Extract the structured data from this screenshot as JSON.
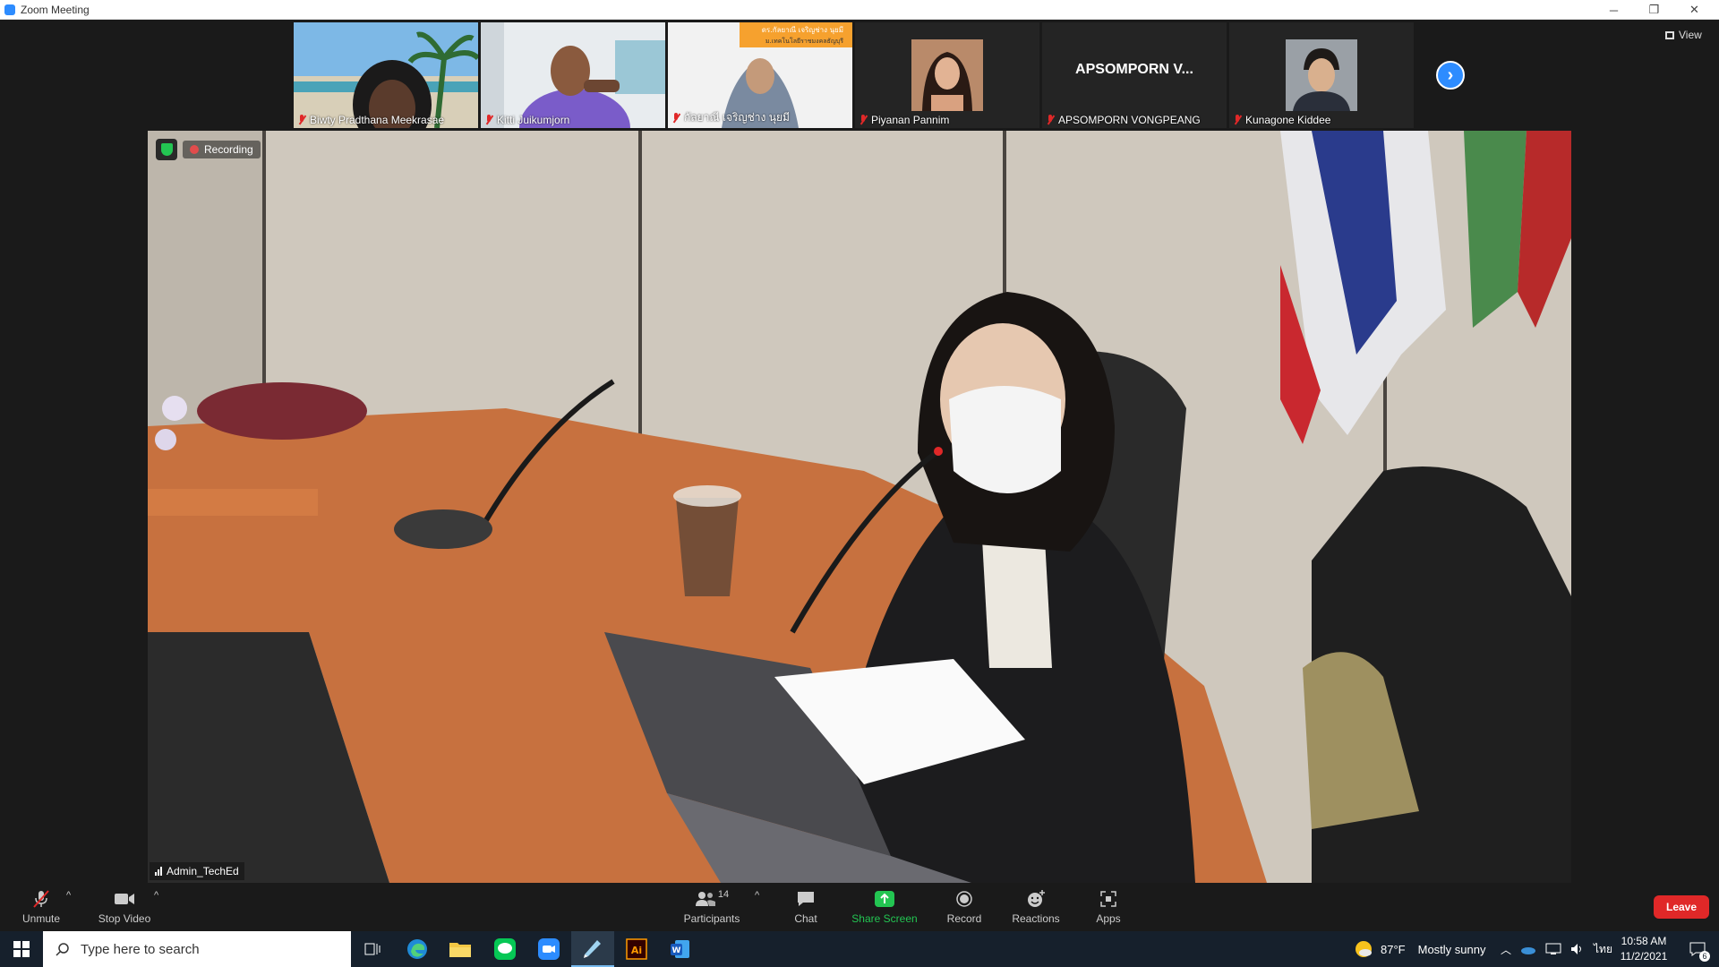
{
  "window": {
    "title": "Zoom Meeting",
    "minimize": "─",
    "restore": "❐",
    "close": "✕"
  },
  "gallery": {
    "participants": [
      {
        "name": "Biwty Pradthana Meekrasae",
        "muted": true
      },
      {
        "name": "Kitti Juikumjorn",
        "muted": true
      },
      {
        "name": "กัลยาณี เจริญช่าง นุยมี",
        "muted": true,
        "banner": "ดร.กัลยาณี เจริญช่าง นุยมี",
        "banner2": "ม.เทคโนโลยีราชมงคลธัญบุรี"
      },
      {
        "name": "Piyanan Pannim",
        "muted": true
      },
      {
        "name": "APSOMPORN VONGPEANG",
        "muted": true,
        "tile_text": "APSOMPORN  V..."
      },
      {
        "name": "Kunagone Kiddee",
        "muted": true
      }
    ],
    "view_label": "View"
  },
  "main": {
    "recording_label": "Recording",
    "speaker_name": "Admin_TechEd"
  },
  "toolbar": {
    "unmute": "Unmute",
    "stop_video": "Stop Video",
    "participants": "Participants",
    "participants_count": "14",
    "chat": "Chat",
    "share_screen": "Share Screen",
    "record": "Record",
    "reactions": "Reactions",
    "apps": "Apps",
    "leave": "Leave"
  },
  "taskbar": {
    "search_placeholder": "Type here to search",
    "temperature": "87°F",
    "weather": "Mostly sunny",
    "language": "ไทย",
    "time": "10:58 AM",
    "date": "11/2/2021",
    "notifications": "6"
  },
  "colors": {
    "zoom_blue": "#2d8cff",
    "leave_red": "#e02828",
    "share_green": "#23c552",
    "taskbar_bg": "#16202c"
  }
}
